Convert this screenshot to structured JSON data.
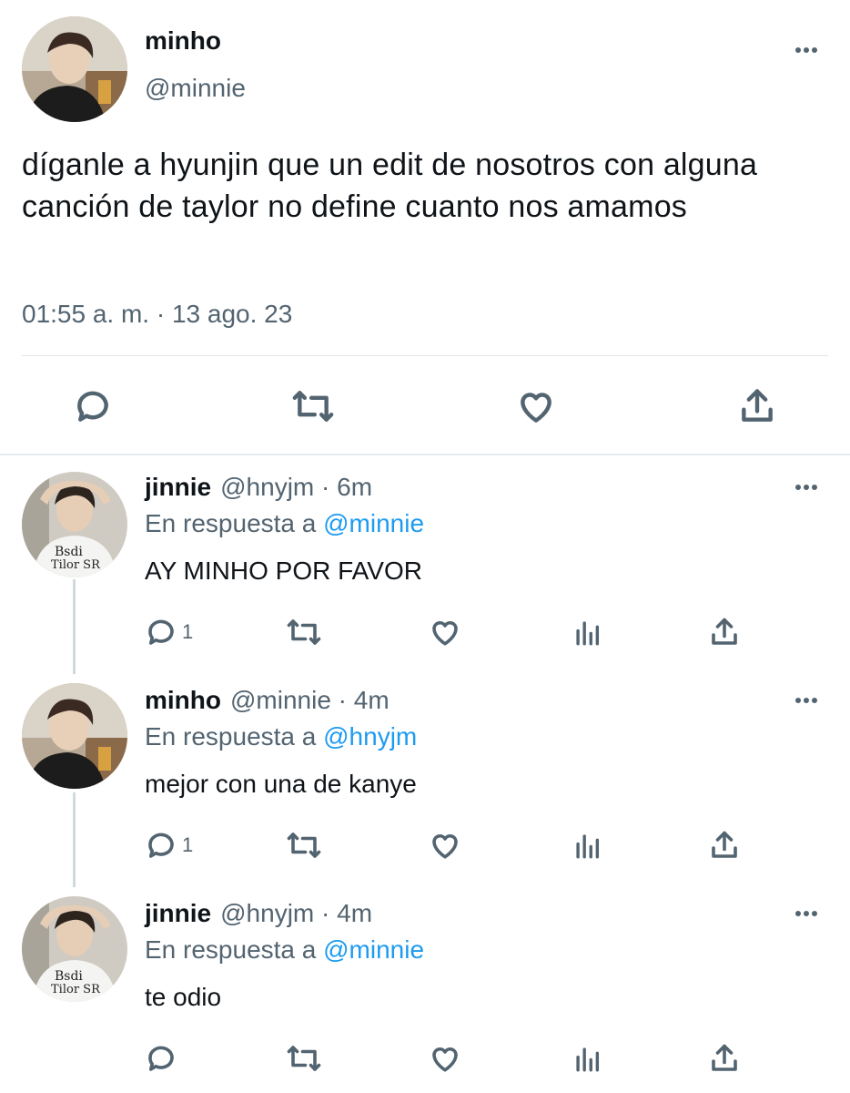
{
  "main": {
    "author_name": "minho",
    "author_handle": "@minnie",
    "text": "díganle a hyunjin que un edit de nosotros con alguna canción de taylor no define cuanto nos amamos",
    "timestamp": "01:55 a. m. · 13 ago. 23",
    "actions": [
      "reply-icon",
      "retweet-icon",
      "like-icon",
      "share-icon"
    ]
  },
  "replies": [
    {
      "name": "jinnie",
      "handle_time": "@hnyjm · 6m",
      "reply_prefix": "En respuesta a",
      "reply_to": "@minnie",
      "text": "AY MINHO POR FAVOR",
      "reply_count": "1"
    },
    {
      "name": "minho",
      "handle_time": "@minnie · 4m",
      "reply_prefix": "En respuesta a",
      "reply_to": "@hnyjm",
      "text": "mejor con una de kanye",
      "reply_count": "1"
    },
    {
      "name": "jinnie",
      "handle_time": "@hnyjm · 4m",
      "reply_prefix": "En respuesta a",
      "reply_to": "@minnie",
      "text": "te odio",
      "reply_count": ""
    }
  ],
  "colors": {
    "accent": "#1d9bf0",
    "muted": "#536471",
    "text": "#0f1419"
  }
}
